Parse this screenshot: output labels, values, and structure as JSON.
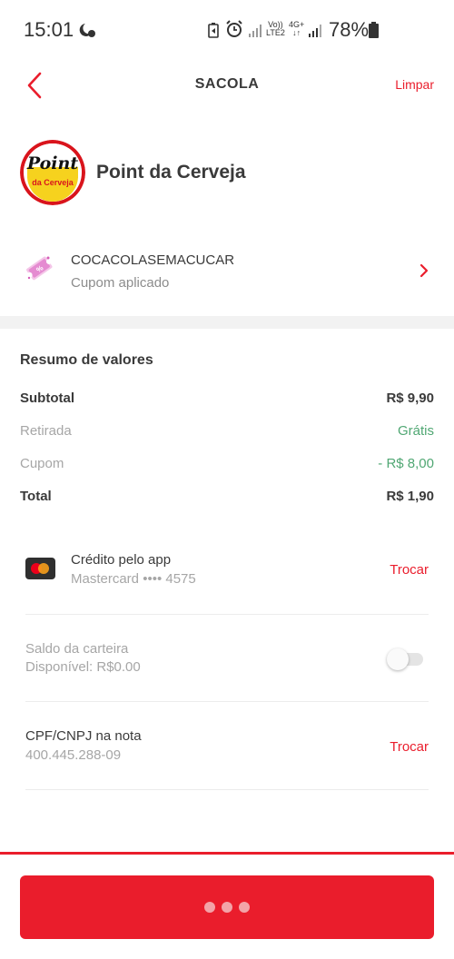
{
  "status_bar": {
    "time": "15:01",
    "network_top": "Vo))",
    "network_bottom": "LTE2",
    "data_top": "4G+",
    "data_bottom": "↓↑",
    "battery": "78%"
  },
  "header": {
    "title": "SACOLA",
    "clear_label": "Limpar"
  },
  "store": {
    "name": "Point da Cerveja",
    "logo_text_top": "Point",
    "logo_text_bottom": "da Cerveja"
  },
  "coupon": {
    "code": "COCACOLASEMACUCAR",
    "status": "Cupom aplicado"
  },
  "summary": {
    "title": "Resumo de valores",
    "rows": [
      {
        "label": "Subtotal",
        "value": "R$ 9,90"
      },
      {
        "label": "Retirada",
        "value": "Grátis"
      },
      {
        "label": "Cupom",
        "value": "- R$ 8,00"
      },
      {
        "label": "Total",
        "value": "R$ 1,90"
      }
    ]
  },
  "payment": {
    "title": "Crédito pelo app",
    "card": "Mastercard •••• 4575",
    "action": "Trocar"
  },
  "wallet": {
    "title": "Saldo da carteira",
    "available": "Disponível: R$0.00",
    "toggle_on": false
  },
  "tax_id": {
    "title": "CPF/CNPJ na nota",
    "value": "400.445.288-09",
    "action": "Trocar"
  },
  "colors": {
    "accent": "#ea1d2c",
    "success": "#50a773",
    "muted": "#a6a6a6"
  },
  "icons": [
    "moon-icon",
    "alarm-icon",
    "signal-icon",
    "battery-icon",
    "back-chevron-icon",
    "coupon-ticket-icon",
    "chevron-right-icon",
    "mastercard-icon",
    "loading-dots-icon"
  ]
}
